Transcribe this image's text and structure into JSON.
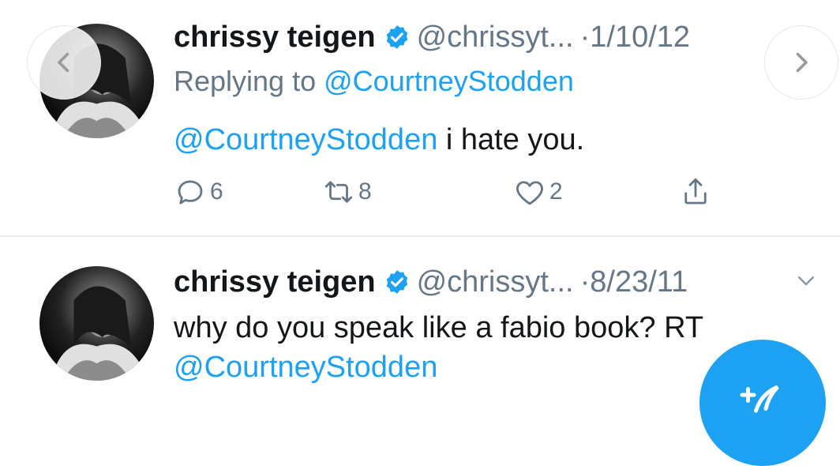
{
  "tweets": [
    {
      "name": "chrissy teigen",
      "handle": "@chrissyt...",
      "dot": "·",
      "date": "1/10/12",
      "replying_prefix": "Replying to",
      "replying_handle": "@CourtneyStodden",
      "mention": "@CourtneyStodden",
      "text": " i hate you.",
      "counts": {
        "replies": "6",
        "retweets": "8",
        "likes": "2"
      }
    },
    {
      "name": "chrissy teigen",
      "handle": "@chrissyt...",
      "dot": "·",
      "date": "8/23/11",
      "text": "why do you speak like a fabio book? RT ",
      "mention": "@CourtneyStodden"
    }
  ],
  "colors": {
    "accent": "#1da1f2",
    "secondary_text": "#657786",
    "primary_text": "#14171a",
    "divider": "#e6ecf0"
  },
  "icons": [
    "verified-badge-icon",
    "reply-icon",
    "retweet-icon",
    "like-icon",
    "share-icon",
    "chevron-down-icon",
    "chevron-left-icon",
    "chevron-right-icon",
    "compose-icon"
  ]
}
